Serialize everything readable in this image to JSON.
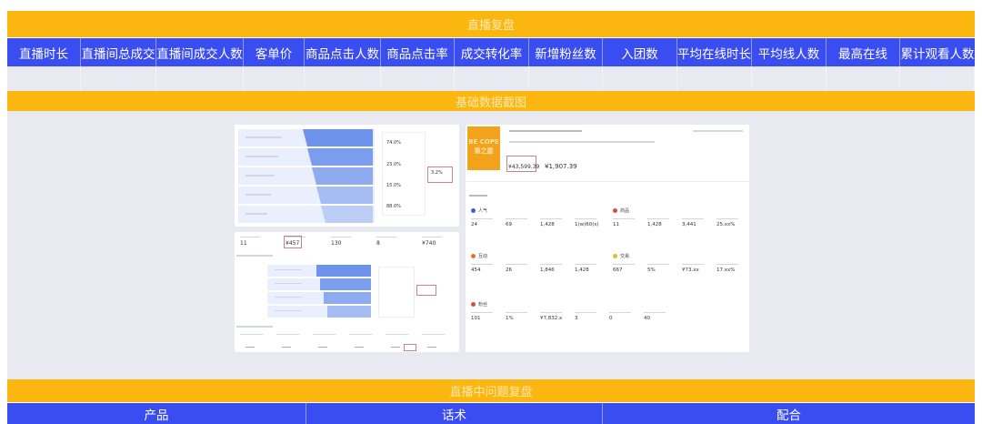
{
  "header": {
    "title": "直播复盘"
  },
  "columns": [
    "直播时长",
    "直播间总成交",
    "直播间成交人数",
    "客单价",
    "商品点击人数",
    "商品点击率",
    "成交转化率",
    "新增粉丝数",
    "入团数",
    "平均在线时长",
    "平均线人数",
    "最高在线",
    "累计观看人数"
  ],
  "section2": {
    "title": "基础数据截图"
  },
  "screenshot_left": {
    "funnel_pct": [
      "74.0%",
      "23.0%",
      "15.0%",
      "88.0%"
    ],
    "highlight_pct": "3.2%",
    "stats": [
      "11",
      "¥457",
      "130",
      "8",
      "¥740"
    ]
  },
  "screenshot_right": {
    "logo_text": "BE COPE 第之屋",
    "amount_main": "¥43,599.39",
    "amount_second": "¥1,907.39",
    "groups": [
      {
        "name": "人气",
        "icon": "person-icon",
        "color": "#3a62c9",
        "values": [
          "24",
          "69",
          "1,428",
          "1(w)60(s)"
        ]
      },
      {
        "name": "商品",
        "icon": "bag-icon",
        "color": "#d94b4b",
        "values": [
          "11",
          "1,428",
          "3,441",
          "25.xx%"
        ]
      },
      {
        "name": "互动",
        "icon": "chat-icon",
        "color": "#e0743a",
        "values": [
          "454",
          "26",
          "1,846",
          "1,428"
        ]
      },
      {
        "name": "交易",
        "icon": "cart-icon",
        "color": "#d8c23a",
        "values": [
          "667",
          "5%",
          "¥73.xx",
          "17.xx%"
        ]
      },
      {
        "name": "粉丝",
        "icon": "fans-icon",
        "color": "#d94b4b",
        "values": [
          "101",
          "1%",
          "¥7,832.x",
          "3",
          "0",
          "40"
        ]
      }
    ]
  },
  "section3": {
    "title": "直播中问题复盘",
    "columns": [
      "产品",
      "话术",
      "配合"
    ]
  },
  "colors": {
    "yellow": "#fbb60f",
    "blue": "#3a4df0",
    "grey": "#e8e9f1"
  }
}
